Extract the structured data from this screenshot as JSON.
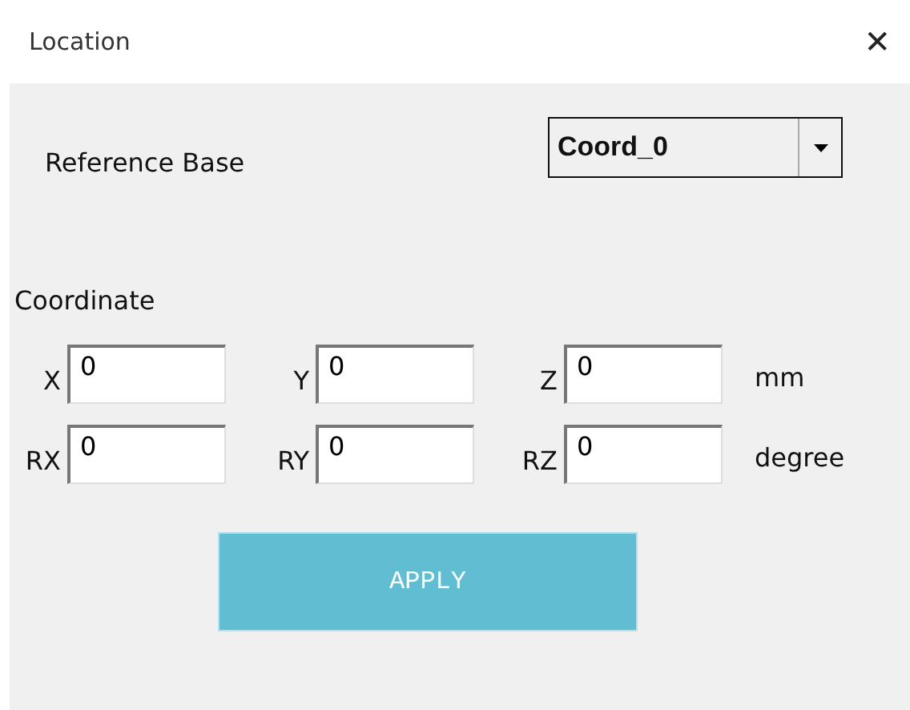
{
  "window": {
    "title": "Location",
    "close": "✕"
  },
  "reference_base": {
    "label": "Reference Base",
    "value": "Coord_0"
  },
  "coordinate": {
    "label": "Coordinate",
    "rows": [
      {
        "unit": "mm",
        "fields": [
          {
            "label": "X",
            "value": "0"
          },
          {
            "label": "Y",
            "value": "0"
          },
          {
            "label": "Z",
            "value": "0"
          }
        ]
      },
      {
        "unit": "degree",
        "fields": [
          {
            "label": "RX",
            "value": "0"
          },
          {
            "label": "RY",
            "value": "0"
          },
          {
            "label": "RZ",
            "value": "0"
          }
        ]
      }
    ]
  },
  "buttons": [
    "APPLY"
  ]
}
